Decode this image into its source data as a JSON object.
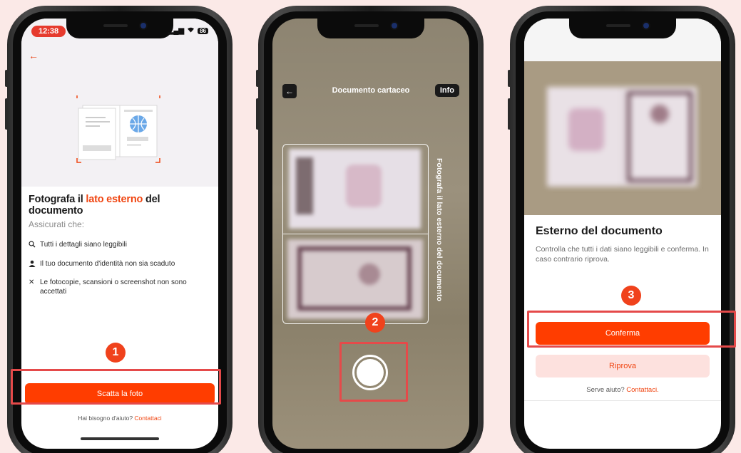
{
  "screen1": {
    "status_time": "12:38",
    "battery": "86",
    "title_prefix": "Fotografa il ",
    "title_accent": "lato esterno",
    "title_suffix": " del documento",
    "subtitle": "Assicurati che:",
    "checks": [
      {
        "icon": "search-icon",
        "text": "Tutti i dettagli siano leggibili"
      },
      {
        "icon": "person-icon",
        "text": "Il tuo documento d'identità non sia scaduto"
      },
      {
        "icon": "close-icon",
        "text": "Le fotocopie, scansioni o screenshot non sono accettati"
      }
    ],
    "step": "1",
    "button": "Scatta la foto",
    "help_text": "Hai bisogno d'aiuto? ",
    "help_link": "Contattaci"
  },
  "screen2": {
    "title": "Documento cartaceo",
    "info_button": "Info",
    "vertical_label": "Fotografa il lato esterno del documento",
    "step": "2"
  },
  "screen3": {
    "title": "Esterno del documento",
    "description": "Controlla che tutti i dati siano leggibili e conferma. In caso contrario riprova.",
    "step": "3",
    "confirm_button": "Conferma",
    "retry_button": "Riprova",
    "help_text": "Serve aiuto? ",
    "help_link": "Contattaci."
  },
  "colors": {
    "accent": "#ff3d00",
    "highlight": "#e54a4a",
    "background": "#fbe9e7"
  }
}
